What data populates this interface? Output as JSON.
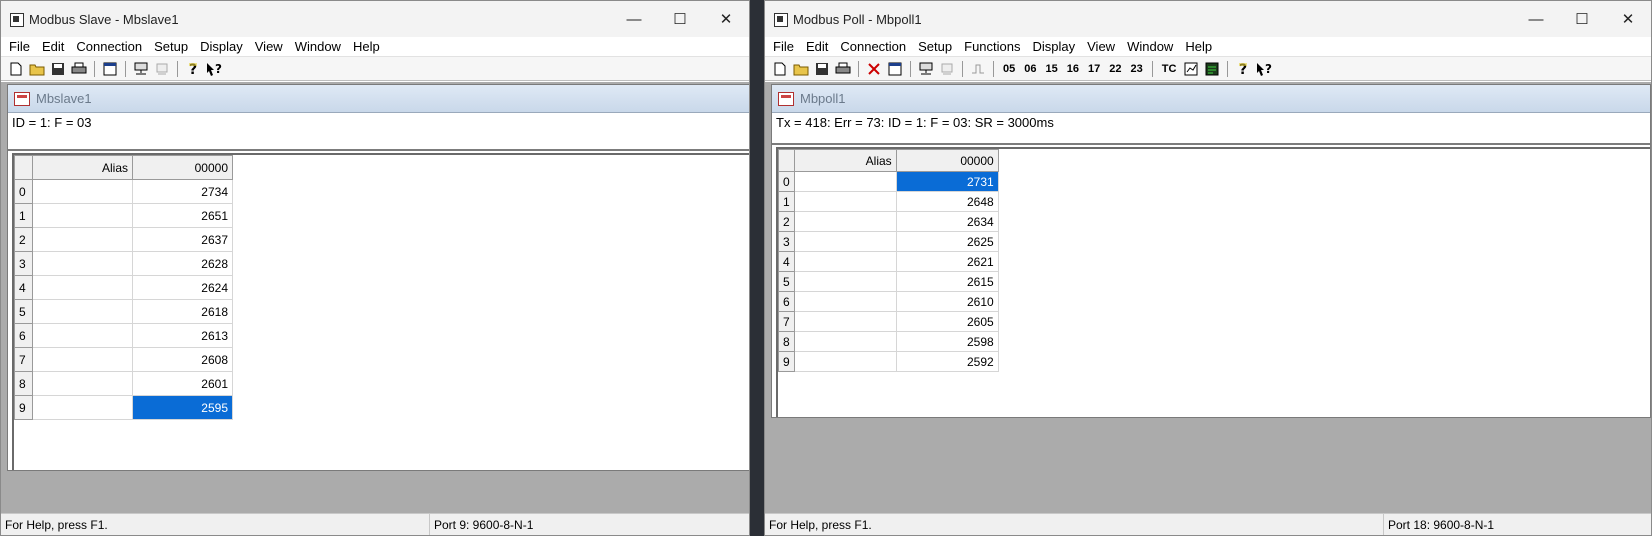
{
  "slave": {
    "title": "Modbus Slave - Mbslave1",
    "menu": [
      "File",
      "Edit",
      "Connection",
      "Setup",
      "Display",
      "View",
      "Window",
      "Help"
    ],
    "child_title": "Mbslave1",
    "info": "ID = 1: F = 03",
    "columns": {
      "alias": "Alias",
      "reg": "00000"
    },
    "rows": [
      {
        "idx": "0",
        "value": "2734"
      },
      {
        "idx": "1",
        "value": "2651"
      },
      {
        "idx": "2",
        "value": "2637"
      },
      {
        "idx": "3",
        "value": "2628"
      },
      {
        "idx": "4",
        "value": "2624"
      },
      {
        "idx": "5",
        "value": "2618"
      },
      {
        "idx": "6",
        "value": "2613"
      },
      {
        "idx": "7",
        "value": "2608"
      },
      {
        "idx": "8",
        "value": "2601"
      },
      {
        "idx": "9",
        "value": "2595"
      }
    ],
    "selected_row": 9,
    "status_help": "For Help, press F1.",
    "status_port": "Port 9: 9600-8-N-1"
  },
  "poll": {
    "title": "Modbus Poll - Mbpoll1",
    "menu": [
      "File",
      "Edit",
      "Connection",
      "Setup",
      "Functions",
      "Display",
      "View",
      "Window",
      "Help"
    ],
    "toolbar_codes": [
      "05",
      "06",
      "15",
      "16",
      "17",
      "22",
      "23"
    ],
    "toolbar_tc": "TC",
    "child_title": "Mbpoll1",
    "info": "Tx = 418: Err = 73: ID = 1: F = 03: SR = 3000ms",
    "columns": {
      "alias": "Alias",
      "reg": "00000"
    },
    "rows": [
      {
        "idx": "0",
        "value": "2731"
      },
      {
        "idx": "1",
        "value": "2648"
      },
      {
        "idx": "2",
        "value": "2634"
      },
      {
        "idx": "3",
        "value": "2625"
      },
      {
        "idx": "4",
        "value": "2621"
      },
      {
        "idx": "5",
        "value": "2615"
      },
      {
        "idx": "6",
        "value": "2610"
      },
      {
        "idx": "7",
        "value": "2605"
      },
      {
        "idx": "8",
        "value": "2598"
      },
      {
        "idx": "9",
        "value": "2592"
      }
    ],
    "selected_row": 0,
    "status_help": "For Help, press F1.",
    "status_port": "Port 18: 9600-8-N-1"
  },
  "icons": {
    "minimize": "—",
    "maximize": "☐",
    "close": "✕"
  },
  "colors": {
    "selection": "#0a6cd6",
    "mdi_background": "#ababab"
  }
}
